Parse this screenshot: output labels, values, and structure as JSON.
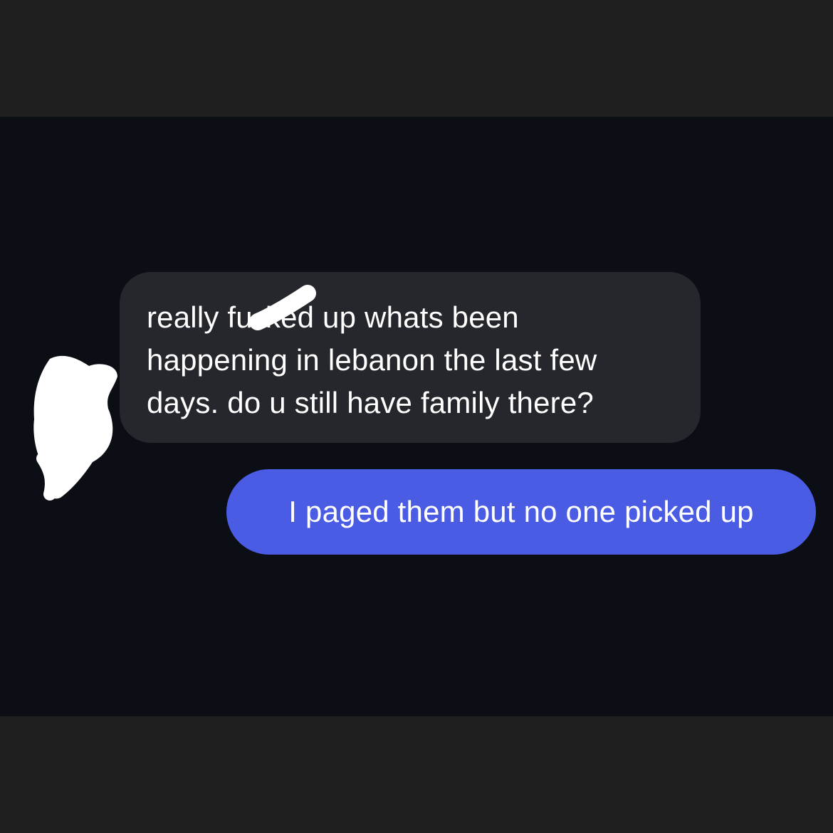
{
  "conversation": {
    "incoming_message": {
      "lines": [
        "really fu",
        "ked up whats been",
        "happening in lebanon the last few",
        "days. do u still have family there?"
      ]
    },
    "outgoing_message": {
      "text": "I paged them but no one picked up"
    }
  },
  "colors": {
    "letterbox": "#1f1f1f",
    "chat_background": "#0b0e14",
    "incoming_bubble": "#25272d",
    "outgoing_bubble": "#4a5ce4",
    "text": "#ffffff",
    "redaction_scribble": "#ffffff"
  },
  "icons": {
    "avatar": "redacted-avatar-scribble",
    "redaction": "redaction-stroke"
  }
}
